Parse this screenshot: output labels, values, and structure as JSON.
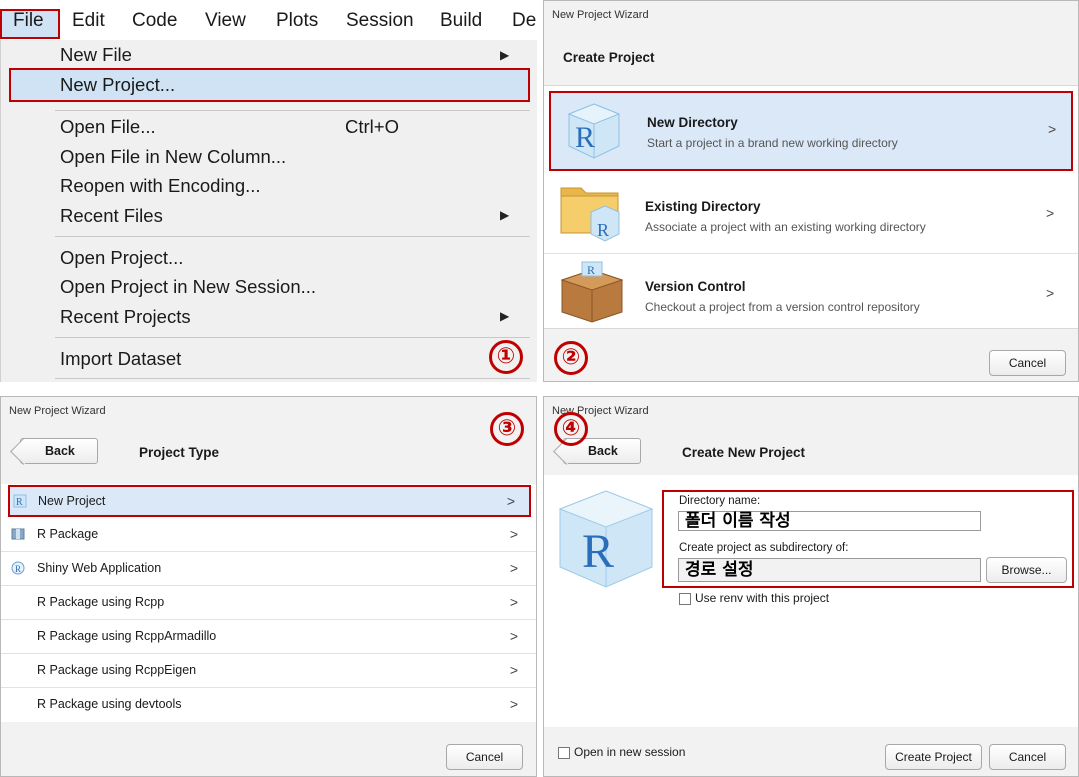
{
  "panel1": {
    "menubar": [
      "File",
      "Edit",
      "Code",
      "View",
      "Plots",
      "Session",
      "Build",
      "De"
    ],
    "items": {
      "new_file": "New File",
      "new_project": "New Project...",
      "open_file": "Open File...",
      "open_file_shortcut": "Ctrl+O",
      "open_file_new_column": "Open File in New Column...",
      "reopen_encoding": "Reopen with Encoding...",
      "recent_files": "Recent Files",
      "open_project": "Open Project...",
      "open_project_new_session": "Open Project in New Session...",
      "recent_projects": "Recent Projects",
      "import_dataset": "Import Dataset"
    },
    "step": "①"
  },
  "panel2": {
    "window_title": "New Project Wizard",
    "header": "Create Project",
    "options": [
      {
        "title": "New Directory",
        "subtitle": "Start a project in a brand new working directory"
      },
      {
        "title": "Existing Directory",
        "subtitle": "Associate a project with an existing working directory"
      },
      {
        "title": "Version Control",
        "subtitle": "Checkout a project from a version control repository"
      }
    ],
    "cancel": "Cancel",
    "step": "②"
  },
  "panel3": {
    "window_title": "New Project Wizard",
    "back": "Back",
    "header": "Project Type",
    "types": [
      "New Project",
      "R Package",
      "Shiny Web Application",
      "R Package using Rcpp",
      "R Package using RcppArmadillo",
      "R Package using RcppEigen",
      "R Package using devtools"
    ],
    "cancel": "Cancel",
    "step": "③"
  },
  "panel4": {
    "window_title": "New Project Wizard",
    "back": "Back",
    "header": "Create New Project",
    "dir_label": "Directory name:",
    "dir_value": "폴더 이름 작성",
    "subdir_label": "Create project as subdirectory of:",
    "subdir_value": "경로 설정",
    "browse": "Browse...",
    "use_renv": "Use renv with this project",
    "open_new_session": "Open in new session",
    "create": "Create Project",
    "cancel": "Cancel",
    "step": "④"
  },
  "colors": {
    "highlight_border": "#c00000",
    "selection": "#dbe8f7",
    "r_blue": "#2a6ebb"
  }
}
